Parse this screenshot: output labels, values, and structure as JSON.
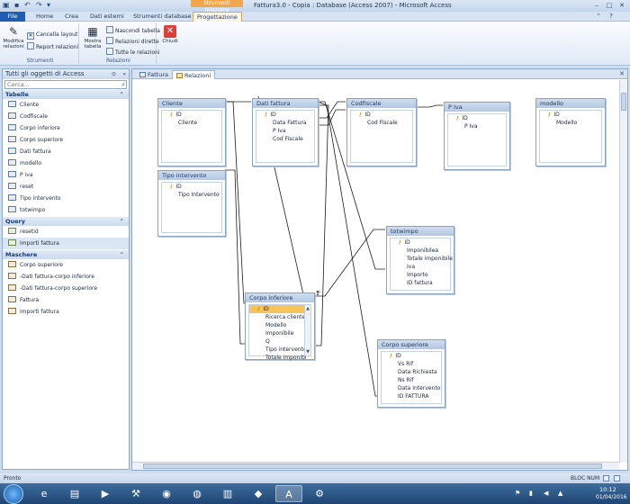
{
  "window": {
    "title": "Fattura3.0 - Copia : Database (Access 2007) - Microsoft Access",
    "context_tab": "Strumenti relazione",
    "qat": [
      "save-icon",
      "undo-icon",
      "redo-icon"
    ]
  },
  "ribbon_tabs": [
    "File",
    "Home",
    "Crea",
    "Dati esterni",
    "Strumenti database",
    "Progettazione"
  ],
  "ribbon": {
    "groups": [
      {
        "label": "Strumenti",
        "big": {
          "label": "Modifica relazioni",
          "icon": "edit-relations-icon"
        },
        "small": [
          {
            "label": "Cancella layout"
          },
          {
            "label": "Report relazioni"
          }
        ]
      },
      {
        "label": "Relazioni",
        "big": {
          "label": "Mostra tabella",
          "icon": "show-table-icon"
        },
        "small": [
          {
            "label": "Nascondi tabella"
          },
          {
            "label": "Relazioni dirette"
          },
          {
            "label": "Tutte le relazioni"
          }
        ]
      },
      {
        "label": "",
        "big": {
          "label": "Chiudi",
          "icon": "close-icon"
        }
      }
    ]
  },
  "nav": {
    "header": "Tutti gli oggetti di Access",
    "search_placeholder": "Cerca...",
    "sections": [
      {
        "title": "Tabelle",
        "items": [
          "Cliente",
          "Codfiscale",
          "Corpo inferiore",
          "Corpo superiore",
          "Dati fattura",
          "modello",
          "P iva",
          "reset",
          "Tipo intervento",
          "totwimpo"
        ]
      },
      {
        "title": "Query",
        "items": [
          "resetid",
          "importi fattura"
        ]
      },
      {
        "title": "Maschere",
        "items": [
          "Corpo superiore",
          "-Dati fattura-corpo inferiore",
          "-Dati fattura-corpo superiore",
          "Fattura",
          "importi fattura"
        ]
      }
    ]
  },
  "doc_tabs": [
    {
      "label": "Fattura",
      "active": false
    },
    {
      "label": "Relazioni",
      "active": true
    }
  ],
  "tables": [
    {
      "title": "Cliente",
      "fields": [
        "ID",
        "Cliente"
      ]
    },
    {
      "title": "Dati fattura",
      "fields": [
        "ID",
        "Data Fattura",
        "P Iva",
        "Cod Fiscale"
      ]
    },
    {
      "title": "Codfiscale",
      "fields": [
        "ID",
        "Cod Fiscale"
      ]
    },
    {
      "title": "P Iva",
      "fields": [
        "ID",
        "P Iva"
      ]
    },
    {
      "title": "modello",
      "fields": [
        "ID",
        "Modello"
      ]
    },
    {
      "title": "Tipo intervento",
      "fields": [
        "ID",
        "Tipo Intervento"
      ]
    },
    {
      "title": "totwimpo",
      "fields": [
        "ID",
        "Imponibilea",
        "Totale imponibile",
        "Iva",
        "Importo",
        "ID fattura"
      ]
    },
    {
      "title": "Corpo inferiore",
      "fields": [
        "ID",
        "Ricerca cliente",
        "Modello",
        "Imponibile",
        "Q",
        "Tipo intervento",
        "Totale imponibi"
      ]
    },
    {
      "title": "Corpo superiore",
      "fields": [
        "ID",
        "Vs Rif",
        "Data Richiesta",
        "Ns Rif",
        "Data Intervento",
        "ID FATTURA"
      ]
    }
  ],
  "status": {
    "left": "Pronto",
    "right": "BLOC NUM"
  },
  "taskbar": {
    "time": "10:12",
    "date": "01/04/2016",
    "apps": [
      "ie-icon",
      "folder-icon",
      "media-icon",
      "tool-icon",
      "chrome-icon",
      "firefox-icon",
      "winrar-icon",
      "excel-icon",
      "access-icon",
      "settings-icon"
    ]
  },
  "colors": {
    "file_tab": "#1f5db3",
    "context_tab": "#f1a64a",
    "highlight_field": "#f6c45a",
    "taskbar": "#1f4673"
  }
}
